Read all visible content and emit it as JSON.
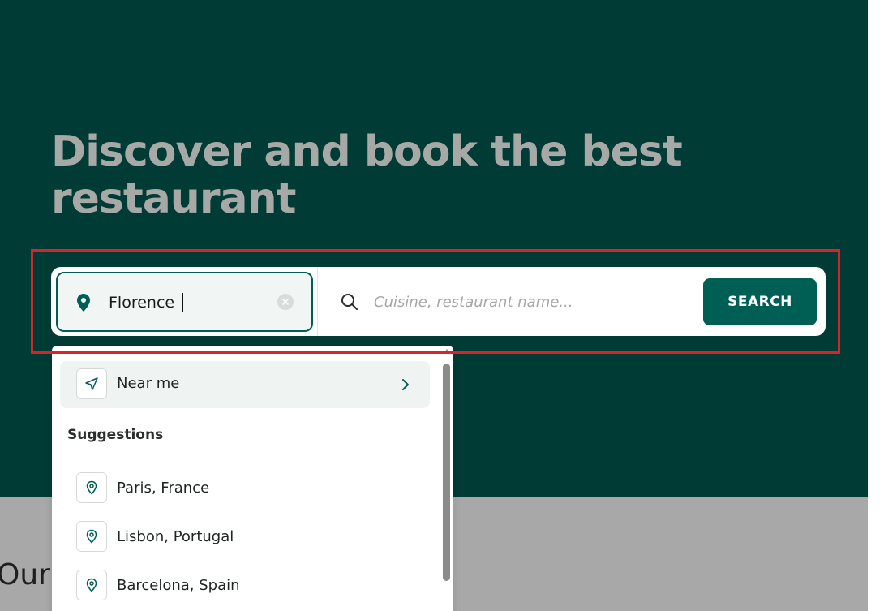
{
  "hero": {
    "title": "Discover and book the best restaurant"
  },
  "search": {
    "location_value": "Florence",
    "query_placeholder": "Cuisine, restaurant name...",
    "button_label": "SEARCH"
  },
  "dropdown": {
    "near_me_label": "Near me",
    "suggestions_heading": "Suggestions",
    "suggestions": [
      {
        "label": "Paris, France"
      },
      {
        "label": "Lisbon, Portugal"
      },
      {
        "label": "Barcelona, Spain"
      }
    ]
  },
  "section": {
    "partial_heading": "Our"
  },
  "colors": {
    "hero_background": "#003b35",
    "primary": "#005f55",
    "highlight": "#d8232a",
    "title_text": "#a7a9a7"
  },
  "icons": {
    "location": "map-pin-icon",
    "clear": "clear-circle-icon",
    "search": "search-icon",
    "near_me": "navigation-arrow-icon",
    "chevron": "chevron-right-icon",
    "suggestion": "location-pin-outline-icon"
  }
}
